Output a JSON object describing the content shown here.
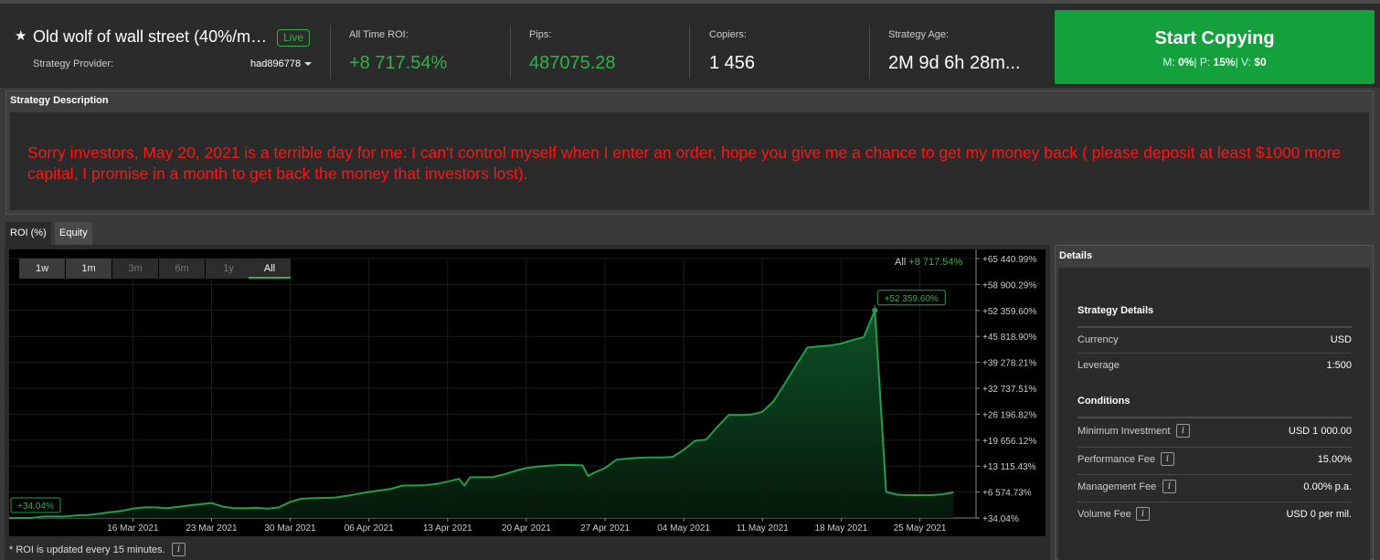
{
  "header": {
    "title": "Old wolf of wall street (40%/m…",
    "live_label": "Live",
    "provider_label": "Strategy Provider:",
    "provider_value": "had896778",
    "stats": [
      {
        "label": "All Time ROI:",
        "value": "+8 717.54%"
      },
      {
        "label": "Pips:",
        "value": "487075.28"
      },
      {
        "label": "Copiers:",
        "value": "1 456"
      },
      {
        "label": "Strategy Age:",
        "value": "2M 9d 6h 28m..."
      }
    ],
    "copy_button": {
      "title": "Start Copying",
      "m_label": "M:",
      "m_value": "0%",
      "p_label": "| P:",
      "p_value": "15%",
      "v_label": "| V:",
      "v_value": "$0"
    }
  },
  "description": {
    "header": "Strategy Description",
    "text": "Sorry investors, May 20, 2021 is a terrible day for me: I can't control myself when I enter an order, hope you give me a chance to get my money back ( please deposit at least $1000 more capital, I promise in a month to get back the money that investors lost)."
  },
  "tabs": [
    "ROI (%)",
    "Equity"
  ],
  "chart": {
    "range_buttons": [
      "1w",
      "1m",
      "3m",
      "6m",
      "1y",
      "All"
    ],
    "all_label": "All",
    "all_value": "+8 717.54%",
    "note": "* ROI is updated every 15 minutes."
  },
  "chart_data": {
    "type": "area",
    "y_tick_labels": [
      "+65 440.99%",
      "+58 900.29%",
      "+52 359.60%",
      "+45 818.90%",
      "+39 278.21%",
      "+32 737.51%",
      "+26 196.82%",
      "+19 656.12%",
      "+13 115.43%",
      "+6 574.73%",
      "+34.04%"
    ],
    "y_ticks": [
      65440.99,
      58900.29,
      52359.6,
      45818.9,
      39278.21,
      32737.51,
      26196.82,
      19656.12,
      13115.43,
      6574.73,
      34.04
    ],
    "x_tick_labels": [
      "16 Mar 2021",
      "23 Mar 2021",
      "30 Mar 2021",
      "06 Apr 2021",
      "13 Apr 2021",
      "20 Apr 2021",
      "27 Apr 2021",
      "04 May 2021",
      "11 May 2021",
      "18 May 2021",
      "25 May 2021"
    ],
    "x_tick_days": [
      16,
      23,
      30,
      37,
      44,
      51,
      58,
      65,
      72,
      79,
      86
    ],
    "ylim": [
      34.04,
      65440.99
    ],
    "xlim": [
      5,
      91
    ],
    "x_unit": "days from 1 Mar 2021",
    "points": [
      [
        5,
        34.04
      ],
      [
        7,
        34.04
      ],
      [
        8,
        400
      ],
      [
        10,
        400
      ],
      [
        11,
        700
      ],
      [
        12,
        800
      ],
      [
        13,
        1100
      ],
      [
        14,
        1500
      ],
      [
        15,
        1800
      ],
      [
        16,
        2400
      ],
      [
        17,
        2700
      ],
      [
        18,
        2700
      ],
      [
        19,
        2500
      ],
      [
        20,
        2800
      ],
      [
        21,
        3200
      ],
      [
        22,
        3500
      ],
      [
        23,
        3800
      ],
      [
        24,
        2900
      ],
      [
        25,
        2500
      ],
      [
        26,
        2500
      ],
      [
        27,
        2600
      ],
      [
        28,
        2400
      ],
      [
        29,
        2700
      ],
      [
        30,
        4100
      ],
      [
        31,
        4900
      ],
      [
        32,
        5000
      ],
      [
        33,
        5100
      ],
      [
        34,
        5200
      ],
      [
        35,
        5600
      ],
      [
        36,
        6100
      ],
      [
        37,
        6600
      ],
      [
        38,
        7000
      ],
      [
        39,
        7400
      ],
      [
        40,
        8200
      ],
      [
        41,
        8200
      ],
      [
        42,
        8300
      ],
      [
        43,
        8600
      ],
      [
        44,
        9200
      ],
      [
        45,
        9900
      ],
      [
        45.5,
        8200
      ],
      [
        46,
        10300
      ],
      [
        47,
        10300
      ],
      [
        48,
        10300
      ],
      [
        49,
        11000
      ],
      [
        50,
        11900
      ],
      [
        51,
        12600
      ],
      [
        52,
        13000
      ],
      [
        53,
        13200
      ],
      [
        54,
        13400
      ],
      [
        55,
        13400
      ],
      [
        56,
        13300
      ],
      [
        56.5,
        10600
      ],
      [
        57,
        11400
      ],
      [
        58,
        12600
      ],
      [
        59,
        14700
      ],
      [
        60,
        15000
      ],
      [
        61,
        15200
      ],
      [
        62,
        15300
      ],
      [
        63,
        15300
      ],
      [
        64,
        15400
      ],
      [
        65,
        17200
      ],
      [
        66,
        19500
      ],
      [
        67,
        19800
      ],
      [
        68,
        23000
      ],
      [
        69,
        26000
      ],
      [
        70,
        26000
      ],
      [
        71,
        26100
      ],
      [
        72,
        26800
      ],
      [
        73,
        29500
      ],
      [
        74,
        34000
      ],
      [
        75,
        38600
      ],
      [
        76,
        43000
      ],
      [
        77,
        43300
      ],
      [
        78,
        43500
      ],
      [
        79,
        44000
      ],
      [
        80,
        44900
      ],
      [
        81,
        45600
      ],
      [
        82,
        52359.6
      ],
      [
        83,
        6600
      ],
      [
        84,
        5900
      ],
      [
        85,
        5800
      ],
      [
        86,
        5800
      ],
      [
        87,
        5800
      ],
      [
        88,
        6000
      ],
      [
        89,
        6500
      ]
    ],
    "callout_max": "+52 359.60%",
    "callout_min": "+34.04%",
    "line_color": "#1fa04a",
    "grid": true
  },
  "details": {
    "header": "Details",
    "strategy_section": "Strategy Details",
    "strategy_rows": [
      {
        "label": "Currency",
        "value": "USD"
      },
      {
        "label": "Leverage",
        "value": "1:500"
      }
    ],
    "conditions_section": "Conditions",
    "condition_rows": [
      {
        "label": "Minimum Investment",
        "value": "USD 1 000.00"
      },
      {
        "label": "Performance Fee",
        "value": "15.00%"
      },
      {
        "label": "Management Fee",
        "value": "0.00% p.a."
      },
      {
        "label": "Volume Fee",
        "value": "USD 0 per mil."
      }
    ]
  },
  "colors": {
    "green": "#2fb344",
    "copy_button": "#13a03d",
    "description_text": "#ff1515"
  }
}
